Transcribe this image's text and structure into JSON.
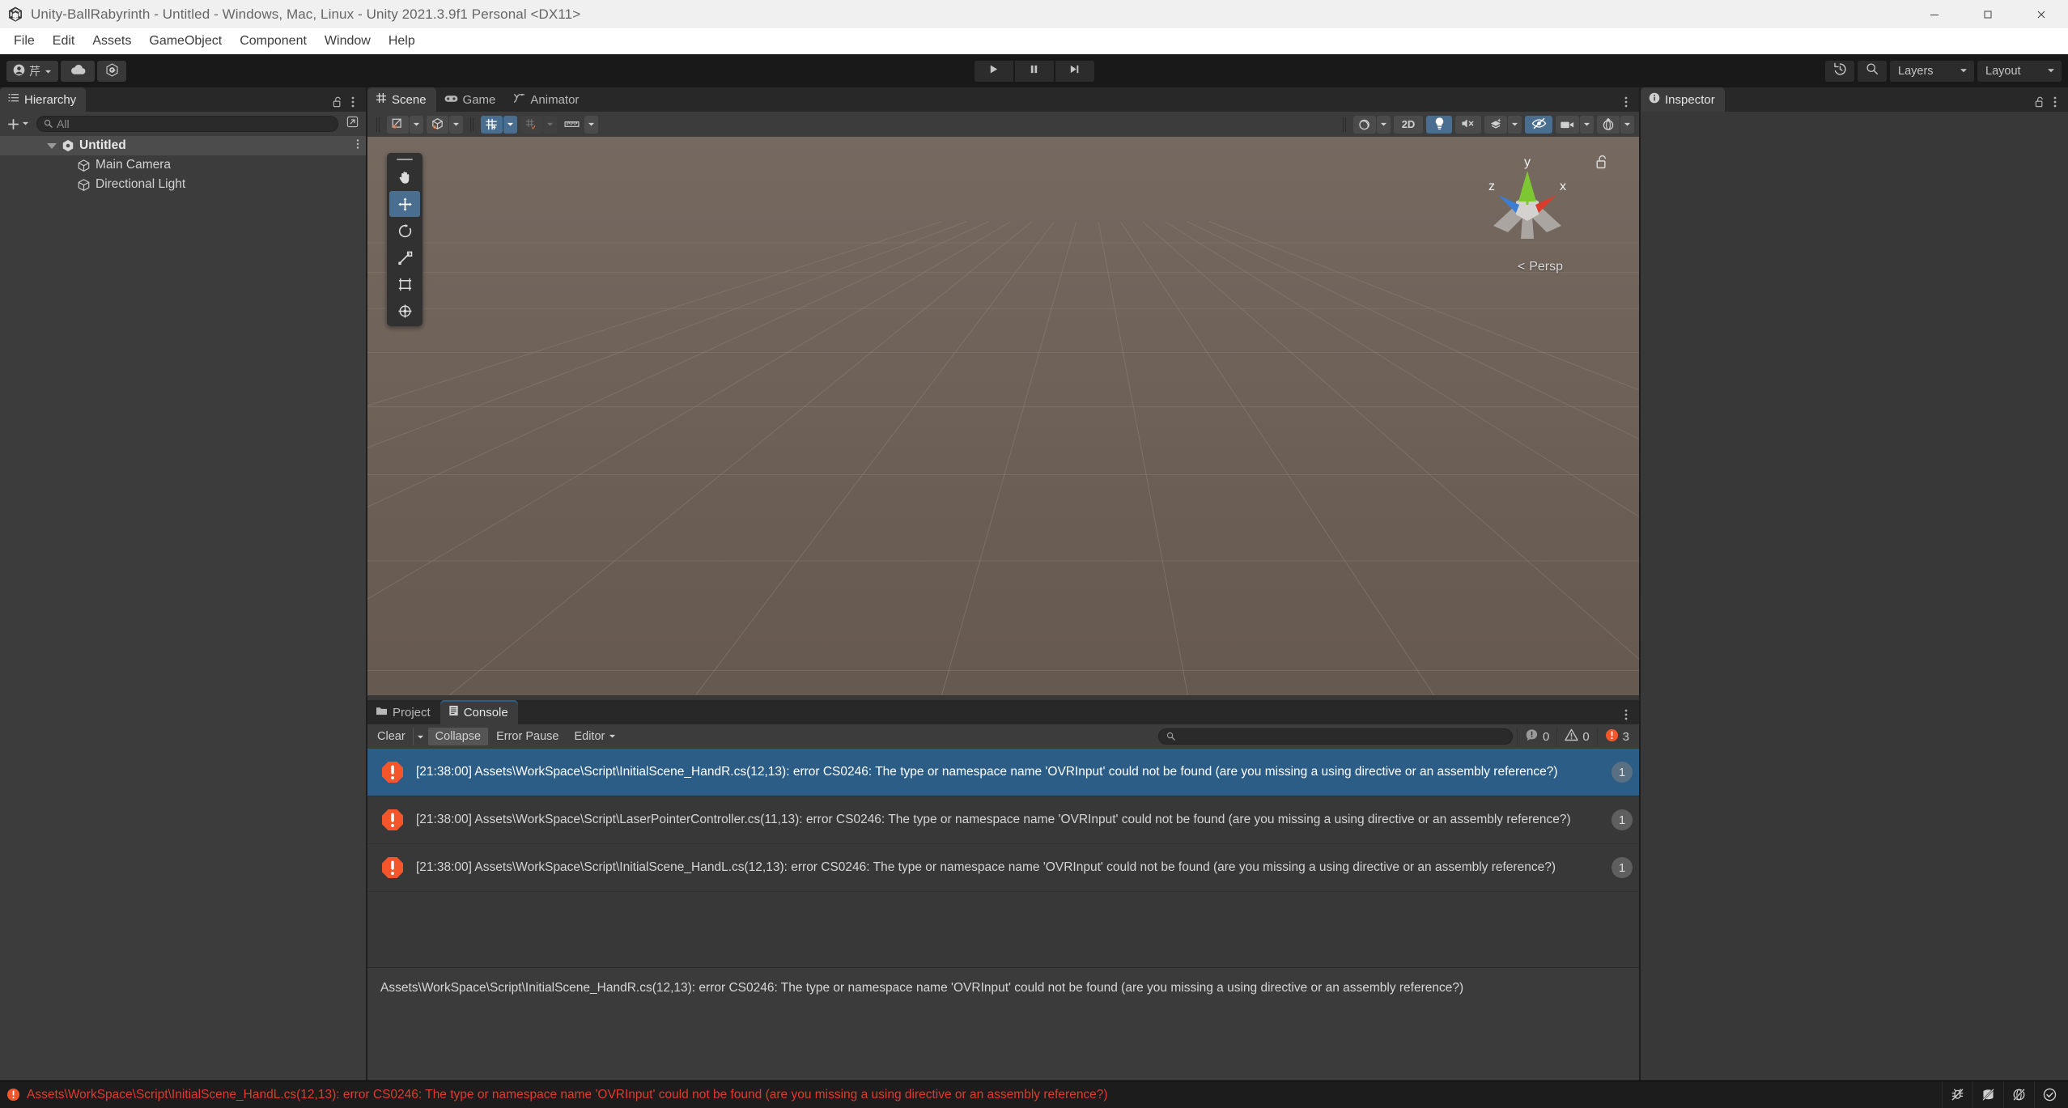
{
  "window": {
    "title": "Unity-BallRabyrinth - Untitled - Windows, Mac, Linux - Unity 2021.3.9f1 Personal <DX11>",
    "app_icon": "unity-logo-icon",
    "minimize_label": "Minimize",
    "maximize_label": "Maximize",
    "close_label": "Close"
  },
  "menubar": {
    "items": [
      {
        "label": "File"
      },
      {
        "label": "Edit"
      },
      {
        "label": "Assets"
      },
      {
        "label": "GameObject"
      },
      {
        "label": "Component"
      },
      {
        "label": "Window"
      },
      {
        "label": "Help"
      }
    ]
  },
  "toolbar": {
    "account_label": "芹",
    "account_icon": "account-person-icon",
    "cloud_icon": "cloud-icon",
    "services_icon": "unity-services-icon",
    "play_icon": "play-icon",
    "pause_icon": "pause-icon",
    "step_icon": "step-icon",
    "undo_history_icon": "undo-history-icon",
    "search_icon": "search-icon",
    "layers_label": "Layers",
    "layout_label": "Layout"
  },
  "hierarchy": {
    "tab_label": "Hierarchy",
    "tab_icon": "hierarchy-icon",
    "lock_icon": "lock-open-icon",
    "menu_icon": "kebab-menu-icon",
    "add_label": "+",
    "search_placeholder": "All",
    "search_icon": "search-icon",
    "expand_icon": "expand-window-icon",
    "items": [
      {
        "label": "Untitled",
        "icon": "unity-scene-icon",
        "depth": 0,
        "expanded": true,
        "selected": true
      },
      {
        "label": "Main Camera",
        "icon": "gameobject-cube-icon",
        "depth": 1,
        "expanded": false,
        "selected": false
      },
      {
        "label": "Directional Light",
        "icon": "gameobject-cube-icon",
        "depth": 1,
        "expanded": false,
        "selected": false
      }
    ]
  },
  "scene": {
    "tabs": [
      {
        "label": "Scene",
        "icon": "scene-grid-icon",
        "active": true
      },
      {
        "label": "Game",
        "icon": "gamepad-icon",
        "active": false
      },
      {
        "label": "Animator",
        "icon": "animator-icon",
        "active": false
      }
    ],
    "menu_icon": "kebab-menu-icon",
    "tools": [
      {
        "name": "hand-tool",
        "icon": "hand-icon",
        "active": false
      },
      {
        "name": "move-tool",
        "icon": "move-icon",
        "active": true
      },
      {
        "name": "rotate-tool",
        "icon": "rotate-icon",
        "active": false
      },
      {
        "name": "scale-tool",
        "icon": "scale-icon",
        "active": false
      },
      {
        "name": "rect-tool",
        "icon": "rect-transform-icon",
        "active": false
      },
      {
        "name": "transform-tool",
        "icon": "combined-transform-icon",
        "active": false
      }
    ],
    "toolbar_left": [
      {
        "name": "draw-mode-dropdown",
        "icon": "shaded-mode-icon",
        "caret": true,
        "state": "normal"
      },
      {
        "name": "gizmo-visibility-dropdown",
        "icon": "cube-gizmo-icon",
        "caret": true,
        "state": "normal"
      },
      {
        "name": "grid-snap-toggle",
        "icon": "grid-snap-icon",
        "caret": true,
        "state": "on"
      },
      {
        "name": "grid-visibility-toggle",
        "icon": "grid-plane-icon",
        "caret": true,
        "state": "off"
      },
      {
        "name": "ruler-toggle",
        "icon": "ruler-icon",
        "caret": true,
        "state": "flat"
      }
    ],
    "toolbar_right": [
      {
        "name": "scene-view-effects",
        "icon": "sphere-fx-icon",
        "caret": true,
        "state": "normal"
      },
      {
        "name": "toggle-2d",
        "label": "2D",
        "state": "normal"
      },
      {
        "name": "toggle-scene-lighting",
        "icon": "lightbulb-icon",
        "state": "on"
      },
      {
        "name": "toggle-audio",
        "icon": "audio-mute-icon",
        "state": "normal"
      },
      {
        "name": "scene-fx-dropdown",
        "icon": "fx-layers-icon",
        "caret": true,
        "state": "normal"
      },
      {
        "name": "toggle-hidden-objects",
        "icon": "eye-off-icon",
        "state": "on"
      },
      {
        "name": "scene-camera-dropdown",
        "icon": "camera-icon",
        "caret": true,
        "state": "normal"
      },
      {
        "name": "gizmos-toggle",
        "icon": "gizmo-globe-icon",
        "caret": true,
        "state": "normal"
      }
    ],
    "gizmo": {
      "axis_x": "x",
      "axis_y": "y",
      "axis_z": "z",
      "color_x": "#db3b2b",
      "color_y": "#7dc832",
      "color_z": "#3a7fd5"
    },
    "persp_label": "Persp",
    "persp_arrow": "<",
    "lock_icon": "lock-open-icon",
    "background_color": "#6e6259"
  },
  "console": {
    "tabs": [
      {
        "label": "Project",
        "icon": "folder-icon",
        "active": false
      },
      {
        "label": "Console",
        "icon": "console-icon",
        "active": true
      }
    ],
    "menu_icon": "kebab-menu-icon",
    "clear_label": "Clear",
    "collapse_label": "Collapse",
    "error_pause_label": "Error Pause",
    "editor_label": "Editor",
    "search_placeholder": "",
    "search_icon": "search-icon",
    "counts": {
      "info": "0",
      "warning": "0",
      "error": "3"
    },
    "count_icons": {
      "info": "info-icon",
      "warning": "warning-icon",
      "error": "error-icon"
    },
    "entries": [
      {
        "icon": "error-icon",
        "text": "[21:38:00] Assets\\WorkSpace\\Script\\InitialScene_HandR.cs(12,13): error CS0246: The type or namespace name 'OVRInput' could not be found (are you missing a using directive or an assembly reference?)",
        "badge": "1",
        "selected": true
      },
      {
        "icon": "error-icon",
        "text": "[21:38:00] Assets\\WorkSpace\\Script\\LaserPointerController.cs(11,13): error CS0246: The type or namespace name 'OVRInput' could not be found (are you missing a using directive or an assembly reference?)",
        "badge": "1",
        "selected": false
      },
      {
        "icon": "error-icon",
        "text": "[21:38:00] Assets\\WorkSpace\\Script\\InitialScene_HandL.cs(12,13): error CS0246: The type or namespace name 'OVRInput' could not be found (are you missing a using directive or an assembly reference?)",
        "badge": "1",
        "selected": false
      }
    ],
    "detail_text": "Assets\\WorkSpace\\Script\\InitialScene_HandR.cs(12,13): error CS0246: The type or namespace name 'OVRInput' could not be found (are you missing a using directive or an assembly reference?)"
  },
  "inspector": {
    "tab_label": "Inspector",
    "tab_icon": "info-icon",
    "lock_icon": "lock-open-icon",
    "menu_icon": "kebab-menu-icon"
  },
  "statusbar": {
    "icon": "error-icon",
    "message": "Assets\\WorkSpace\\Script\\InitialScene_HandL.cs(12,13): error CS0246: The type or namespace name 'OVRInput' could not be found (are you missing a using directive or an assembly reference?)",
    "message_color": "#e03a2f",
    "icons": [
      {
        "name": "debug-bug-off-icon"
      },
      {
        "name": "cache-server-off-icon"
      },
      {
        "name": "code-optimization-off-icon"
      },
      {
        "name": "ready-check-icon"
      }
    ]
  }
}
